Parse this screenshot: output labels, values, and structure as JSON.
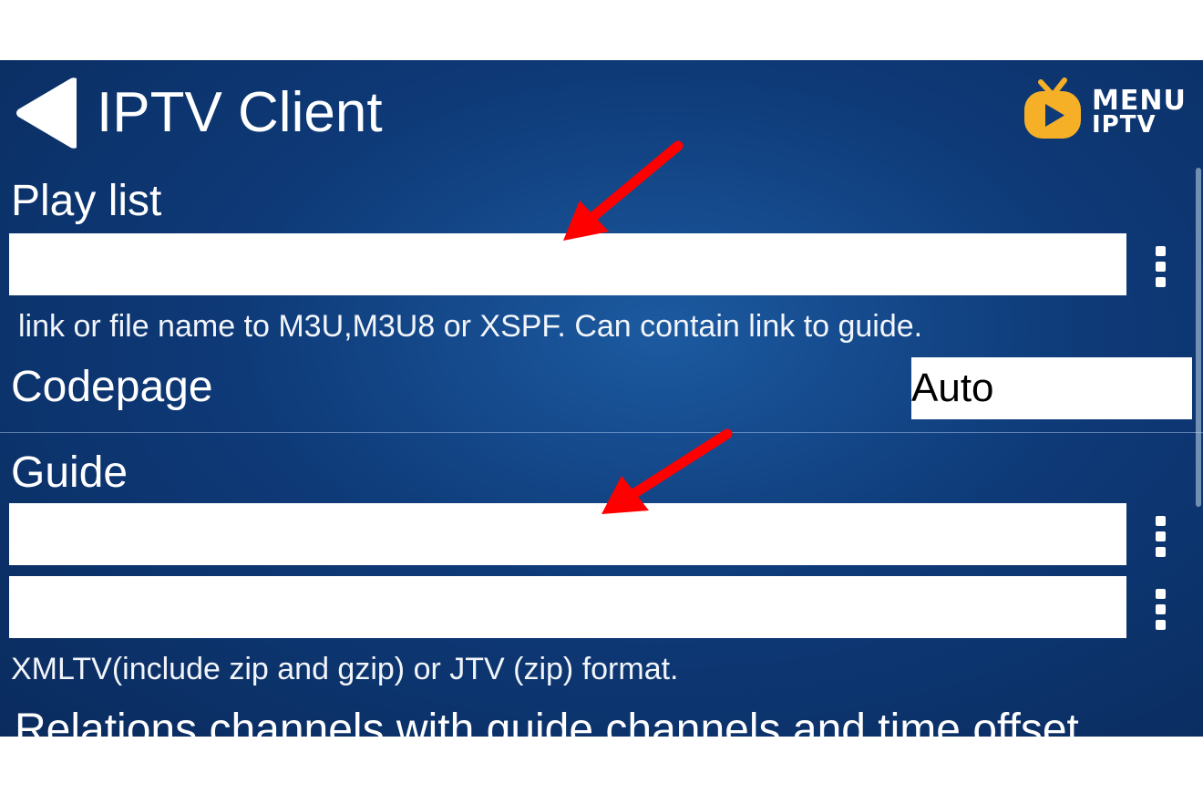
{
  "header": {
    "title": "IPTV Client",
    "back_icon": "back-arrow-icon",
    "logo": {
      "line1": "MENU",
      "line2": "IPTV",
      "icon": "tv-play-icon",
      "color": "#f5b027"
    }
  },
  "playlist": {
    "label": "Play list",
    "value": "",
    "hint": "link or file name to M3U,M3U8 or XSPF. Can contain link to guide.",
    "menu_icon": "more-vertical-icon"
  },
  "codepage": {
    "label": "Codepage",
    "selected": "Auto"
  },
  "guide": {
    "label": "Guide",
    "field1_value": "",
    "field2_value": "",
    "hint": "XMLTV(include zip and gzip) or JTV (zip) format.",
    "menu_icon": "more-vertical-icon"
  },
  "relations": {
    "label": "Relations channels with guide channels and time offset"
  },
  "annotations": {
    "arrow_icon": "red-arrow-icon",
    "arrow_color": "#ff0000"
  },
  "colors": {
    "background": "#0e3a78",
    "text": "#ffffff",
    "field": "#ffffff"
  }
}
